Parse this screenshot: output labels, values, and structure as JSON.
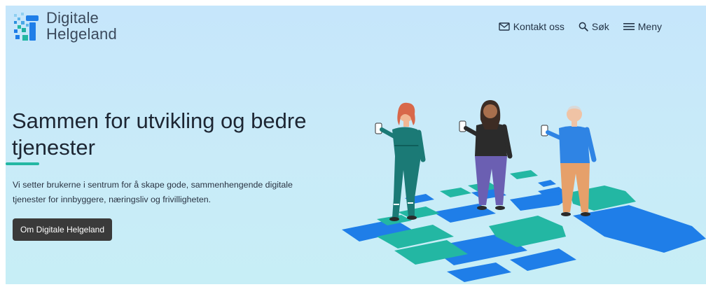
{
  "header": {
    "logo_line1": "Digitale",
    "logo_line2": "Helgeland",
    "nav": [
      {
        "label": "Kontakt oss",
        "icon": "mail-icon"
      },
      {
        "label": "Søk",
        "icon": "search-icon"
      },
      {
        "label": "Meny",
        "icon": "menu-icon"
      }
    ]
  },
  "hero": {
    "title": "Sammen for utvikling og bedre tjenester",
    "intro": "Vi setter brukerne i sentrum for å skape gode, sammenhengende digitale tjenester for innbyggere, næringsliv og frivilligheten.",
    "cta_label": "Om Digitale Helgeland",
    "illustration": "people-holding-phones-on-tiles-illustration"
  },
  "colors": {
    "background": "#c8eaf9",
    "accent": "#23b7a3",
    "tile_blue": "#1f7ee8",
    "button": "#3a3a3a",
    "text": "#1d2633"
  }
}
